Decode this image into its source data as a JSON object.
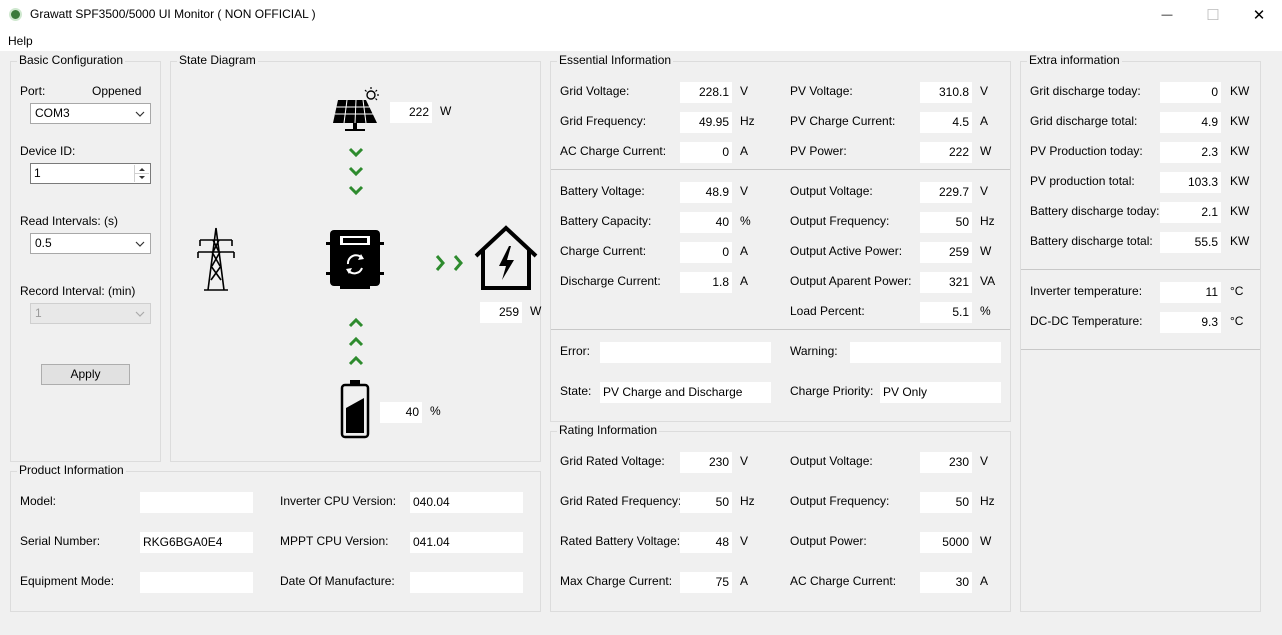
{
  "window": {
    "title": "Grawatt SPF3500/5000 UI Monitor ( NON OFFICIAL )",
    "minimize": "—",
    "maximize": "☐",
    "close": "✕"
  },
  "menu": {
    "help": "Help"
  },
  "basic_config": {
    "title": "Basic Configuration",
    "port_label": "Port:",
    "port_status": "Oppened",
    "port_value": "COM3",
    "device_id_label": "Device ID:",
    "device_id_value": "1",
    "read_interval_label": "Read Intervals: (s)",
    "read_interval_value": "0.5",
    "record_interval_label": "Record Interval: (min)",
    "record_interval_value": "1",
    "apply_label": "Apply"
  },
  "state_diagram": {
    "title": "State Diagram",
    "pv_power": "222",
    "pv_unit": "W",
    "load_power": "259",
    "load_unit": "W",
    "battery_percent": "40",
    "battery_unit": "%",
    "icons": [
      "solar-panel-icon",
      "grid-tower-icon",
      "inverter-icon",
      "house-icon",
      "battery-icon"
    ],
    "arrow_color": "#2e8b2e"
  },
  "essential": {
    "title": "Essential Information",
    "grid_voltage_label": "Grid Voltage:",
    "grid_voltage": "228.1",
    "grid_voltage_unit": "V",
    "grid_freq_label": "Grid Frequency:",
    "grid_freq": "49.95",
    "grid_freq_unit": "Hz",
    "ac_charge_current_label": "AC Charge Current:",
    "ac_charge_current": "0",
    "ac_charge_current_unit": "A",
    "pv_voltage_label": "PV Voltage:",
    "pv_voltage": "310.8",
    "pv_voltage_unit": "V",
    "pv_charge_current_label": "PV Charge Current:",
    "pv_charge_current": "4.5",
    "pv_charge_current_unit": "A",
    "pv_power_label": "PV Power:",
    "pv_power": "222",
    "pv_power_unit": "W",
    "battery_voltage_label": "Battery Voltage:",
    "battery_voltage": "48.9",
    "battery_voltage_unit": "V",
    "battery_capacity_label": "Battery Capacity:",
    "battery_capacity": "40",
    "battery_capacity_unit": "%",
    "charge_current_label": "Charge Current:",
    "charge_current": "0",
    "charge_current_unit": "A",
    "discharge_current_label": "Discharge Current:",
    "discharge_current": "1.8",
    "discharge_current_unit": "A",
    "output_voltage_label": "Output Voltage:",
    "output_voltage": "229.7",
    "output_voltage_unit": "V",
    "output_freq_label": "Output Frequency:",
    "output_freq": "50",
    "output_freq_unit": "Hz",
    "output_active_power_label": "Output Active Power:",
    "output_active_power": "259",
    "output_active_power_unit": "W",
    "output_apparent_power_label": "Output Aparent Power:",
    "output_apparent_power": "321",
    "output_apparent_power_unit": "VA",
    "load_percent_label": "Load Percent:",
    "load_percent": "5.1",
    "load_percent_unit": "%",
    "error_label": "Error:",
    "error": "",
    "warning_label": "Warning:",
    "warning": "",
    "state_label": "State:",
    "state": "PV Charge and Discharge",
    "charge_priority_label": "Charge Priority:",
    "charge_priority": "PV Only"
  },
  "extra": {
    "title": "Extra information",
    "grid_discharge_today_label": "Grit discharge today:",
    "grid_discharge_today": "0",
    "grid_discharge_today_unit": "KW",
    "grid_discharge_total_label": "Grid discharge total:",
    "grid_discharge_total": "4.9",
    "grid_discharge_total_unit": "KW",
    "pv_production_today_label": "PV Production today:",
    "pv_production_today": "2.3",
    "pv_production_today_unit": "KW",
    "pv_production_total_label": "PV production total:",
    "pv_production_total": "103.3",
    "pv_production_total_unit": "KW",
    "battery_discharge_today_label": "Battery discharge today:",
    "battery_discharge_today": "2.1",
    "battery_discharge_today_unit": "KW",
    "battery_discharge_total_label": "Battery discharge total:",
    "battery_discharge_total": "55.5",
    "battery_discharge_total_unit": "KW",
    "inverter_temp_label": "Inverter temperature:",
    "inverter_temp": "11",
    "inverter_temp_unit": "°C",
    "dcdc_temp_label": "DC-DC Temperature:",
    "dcdc_temp": "9.3",
    "dcdc_temp_unit": "°C"
  },
  "product": {
    "title": "Product Information",
    "model_label": "Model:",
    "model": "",
    "serial_label": "Serial Number:",
    "serial": "RKG6BGA0E4",
    "equipment_mode_label": "Equipment Mode:",
    "equipment_mode": "",
    "inverter_cpu_label": "Inverter CPU Version:",
    "inverter_cpu": "040.04",
    "mppt_cpu_label": "MPPT CPU Version:",
    "mppt_cpu": "041.04",
    "manufacture_date_label": "Date Of Manufacture:",
    "manufacture_date": ""
  },
  "rating": {
    "title": "Rating Information",
    "grid_rated_voltage_label": "Grid Rated Voltage:",
    "grid_rated_voltage": "230",
    "grid_rated_voltage_unit": "V",
    "grid_rated_freq_label": "Grid Rated Frequency:",
    "grid_rated_freq": "50",
    "grid_rated_freq_unit": "Hz",
    "rated_battery_voltage_label": "Rated Battery Voltage:",
    "rated_battery_voltage": "48",
    "rated_battery_voltage_unit": "V",
    "max_charge_current_label": "Max Charge Current:",
    "max_charge_current": "75",
    "max_charge_current_unit": "A",
    "output_voltage_label": "Output Voltage:",
    "output_voltage": "230",
    "output_voltage_unit": "V",
    "output_freq_label": "Output Frequency:",
    "output_freq": "50",
    "output_freq_unit": "Hz",
    "output_power_label": "Output Power:",
    "output_power": "5000",
    "output_power_unit": "W",
    "ac_charge_current_label": "AC Charge Current:",
    "ac_charge_current": "30",
    "ac_charge_current_unit": "A"
  }
}
